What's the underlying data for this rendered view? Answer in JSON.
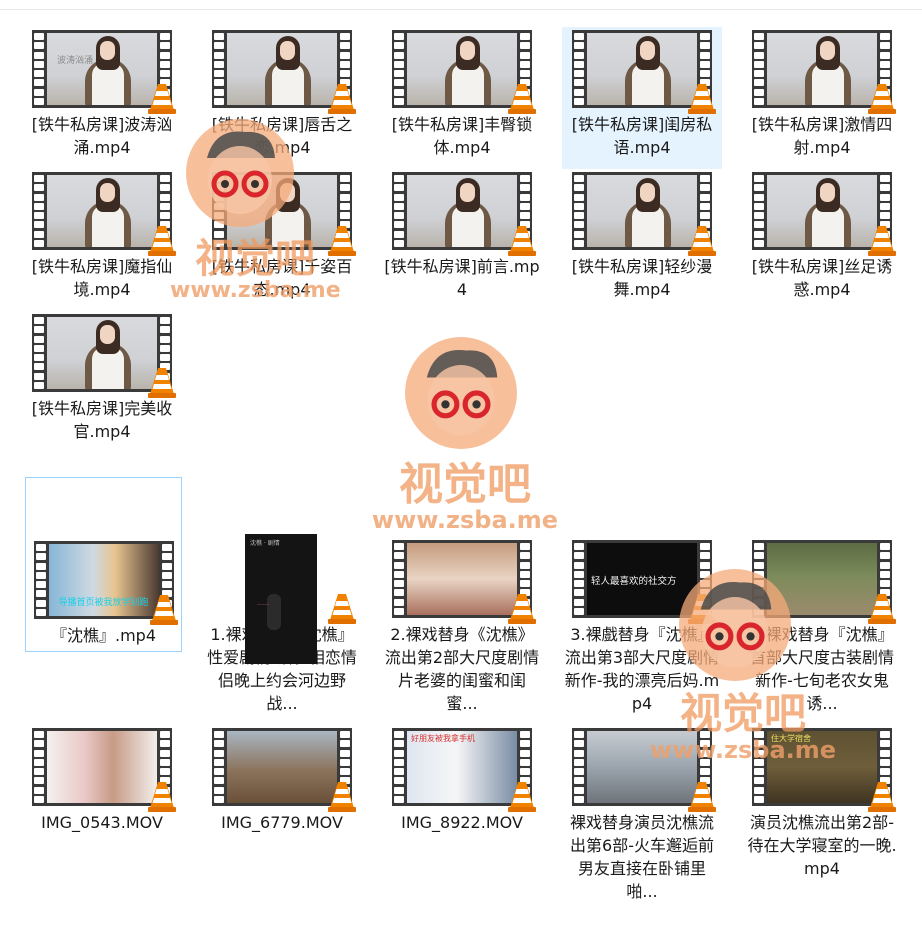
{
  "files": [
    {
      "name": "[铁牛私房课]波涛汹涌.mp4",
      "overlay": "波涛汹涌"
    },
    {
      "name": "[铁牛私房课]唇舌之恋.mp4"
    },
    {
      "name": "[铁牛私房课]丰臀锁体.mp4"
    },
    {
      "name": "[铁牛私房课]闺房私语.mp4"
    },
    {
      "name": "[铁牛私房课]激情四射.mp4"
    },
    {
      "name": "[铁牛私房课]魔指仙境.mp4"
    },
    {
      "name": "[铁牛私房课]千姿百态.mp4"
    },
    {
      "name": "[铁牛私房课]前言.mp4"
    },
    {
      "name": "[铁牛私房课]轻纱漫舞.mp4"
    },
    {
      "name": "[铁牛私房课]丝足诱惑.mp4"
    },
    {
      "name": "[铁牛私房课]完美收官.mp4"
    },
    {
      "name": "『沈樵』.mp4",
      "subtitle": "导播首页被我放学别跑"
    },
    {
      "name": "1.裸戏替身『沈樵』性爱剧情新作-相恋情侣晚上约会河边野战..."
    },
    {
      "name": "2.裸戏替身《沈樵》流出第2部大尺度剧情片老婆的闺蜜和闺蜜..."
    },
    {
      "name": "3.裸戲替身『沈樵』流出第3部大尺度剧情新作-我的漂亮后妈.mp4",
      "subtitle": "轻人最喜欢的社交方"
    },
    {
      "name": "4.裸戏替身『沈樵』首部大尺度古装剧情新作-七旬老农女鬼诱..."
    },
    {
      "name": "IMG_0543.MOV"
    },
    {
      "name": "IMG_6779.MOV"
    },
    {
      "name": "IMG_8922.MOV",
      "subtitle": "好朋友被我拿手机"
    },
    {
      "name": "裸戏替身演员沈樵流出第6部-火车邂逅前男友直接在卧铺里啪..."
    },
    {
      "name": "演员沈樵流出第2部-待在大学寝室的一晚.mp4",
      "subtitle": "住大学宿舍"
    }
  ],
  "watermark": {
    "cn": "视觉吧",
    "url": "www.zsba.me"
  }
}
